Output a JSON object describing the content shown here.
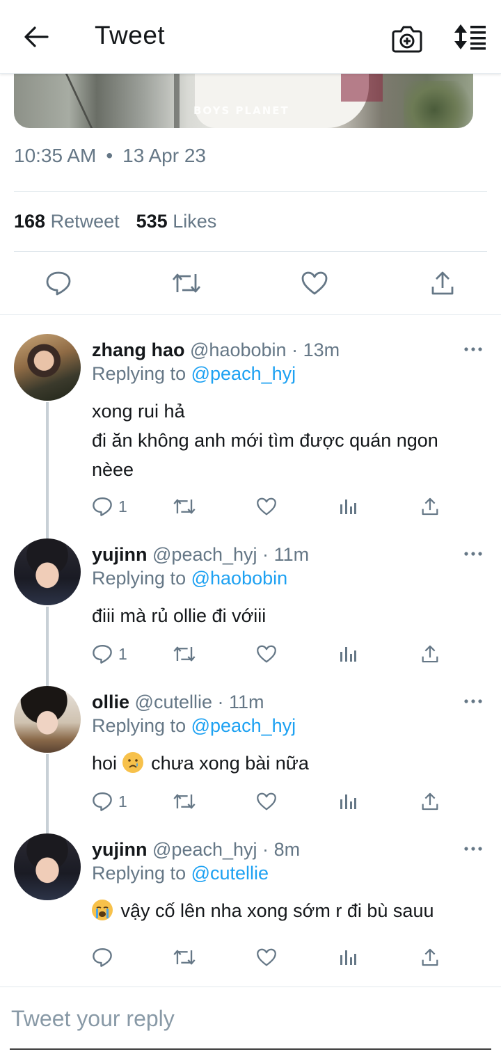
{
  "header": {
    "title": "Tweet",
    "back_icon": "arrow-left-icon",
    "camera_icon": "camera-icon",
    "sort_icon": "sort-icon"
  },
  "media": {
    "watermark": "BOYS PLANET"
  },
  "tweet": {
    "time": "10:35 AM",
    "separator": "•",
    "date": "13 Apr 23",
    "retweet_count": "168",
    "retweet_label": "Retweet",
    "likes_count": "535",
    "likes_label": "Likes"
  },
  "replies": [
    {
      "name": "zhang hao",
      "handle": "@haobobin",
      "time": "13m",
      "replying_prefix": "Replying to",
      "replying_to": "@peach_hyj",
      "lines": [
        "xong rui hả",
        "đi ăn không anh mới tìm được quán ngon",
        "nèee"
      ],
      "reply_count": "1"
    },
    {
      "name": "yujinn",
      "handle": "@peach_hyj",
      "time": "11m",
      "replying_prefix": "Replying to",
      "replying_to": "@haobobin",
      "lines": [
        "điii mà rủ ollie đi vớiii"
      ],
      "reply_count": "1"
    },
    {
      "name": "ollie",
      "handle": "@cutellie",
      "time": "11m",
      "replying_prefix": "Replying to",
      "replying_to": "@peach_hyj",
      "lines": [
        "chưa xong bài nữa"
      ],
      "text_prefix": "hoi",
      "emoji": "crying-face",
      "reply_count": "1"
    },
    {
      "name": "yujinn",
      "handle": "@peach_hyj",
      "time": "8m",
      "replying_prefix": "Replying to",
      "replying_to": "@cutellie",
      "lines": [
        "vậy cố lên nha xong sớm r đi bù sauu"
      ],
      "emoji": "loudly-crying-face",
      "reply_count": ""
    }
  ],
  "composer": {
    "placeholder": "Tweet your reply"
  },
  "colors": {
    "accent": "#1da1f2",
    "muted": "#657786",
    "text": "#14171a",
    "divider": "#e1e8ed"
  }
}
